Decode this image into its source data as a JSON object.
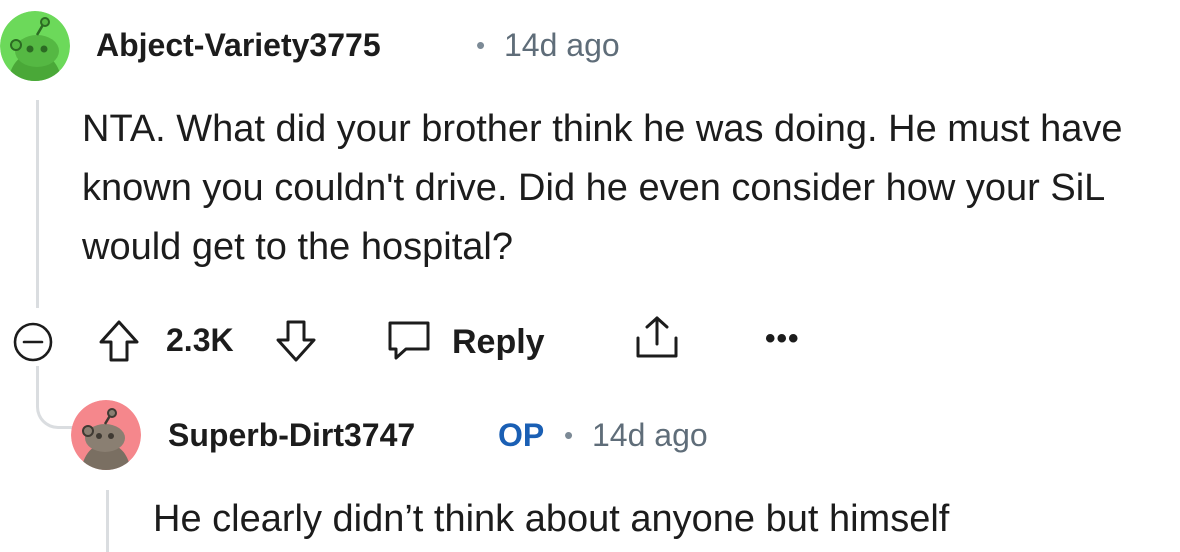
{
  "comment": {
    "username": "Abject-Variety3775",
    "separator": "•",
    "timestamp": "14d ago",
    "body": "NTA. What did your brother think he was doing. He must have known you couldn't drive. Did he even consider how your SiL would get to the hospital?",
    "avatar_color": "#6cd95a",
    "actions": {
      "upvote_icon": "arrow-up-icon",
      "vote_count": "2.3K",
      "downvote_icon": "arrow-down-icon",
      "reply_icon": "speech-bubble-icon",
      "reply_label": "Reply",
      "share_icon": "share-icon",
      "more_label": "•••",
      "collapse_icon": "minus-circle-icon"
    }
  },
  "reply": {
    "username": "Superb-Dirt3747",
    "op_badge": "OP",
    "separator": "•",
    "timestamp": "14d ago",
    "body": "He clearly didn’t think about anyone but himself",
    "avatar_color": "#f5878c"
  },
  "colors": {
    "op_badge": "#1a5fb4",
    "meta_text": "#5f6d79",
    "thread_line": "#dadde0"
  }
}
